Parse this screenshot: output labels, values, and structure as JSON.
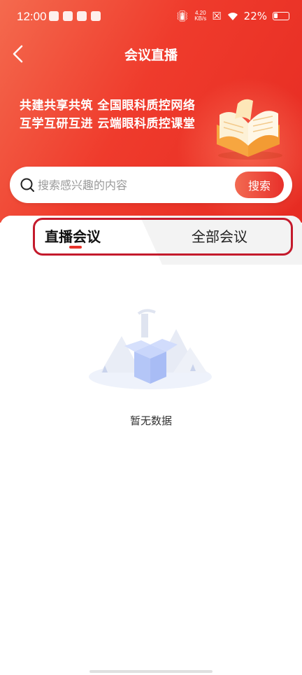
{
  "status_bar": {
    "time": "12:00",
    "net_speed_value": "4.20",
    "net_speed_unit": "KB/s",
    "battery_percent": "22%"
  },
  "nav": {
    "title": "会议直播"
  },
  "banner": {
    "slogan_line1": "共建共享共筑 全国眼科质控网络",
    "slogan_line2": "互学互研互进 云端眼科质控课堂"
  },
  "search": {
    "placeholder": "搜索感兴趣的内容",
    "button_label": "搜索"
  },
  "tabs": [
    {
      "label": "直播会议",
      "active": true
    },
    {
      "label": "全部会议",
      "active": false
    }
  ],
  "empty_state": {
    "message": "暂无数据"
  },
  "colors": {
    "accent": "#e8332a",
    "header_gradient_start": "#f46a4e",
    "highlight_border": "#c41a2c"
  }
}
